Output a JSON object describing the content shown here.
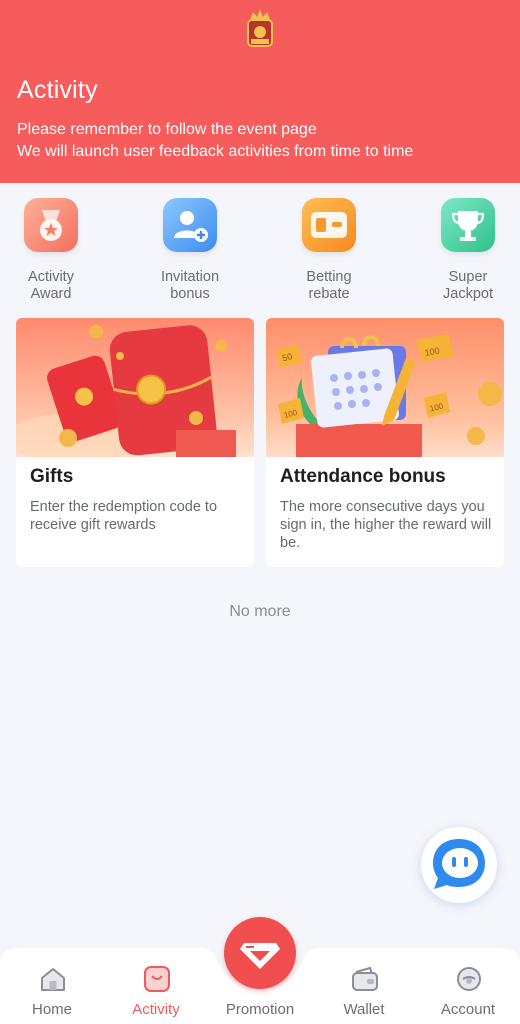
{
  "header": {
    "title": "Activity",
    "line1": "Please remember to follow the event page",
    "line2": "We will launch user feedback activities from time to time"
  },
  "quick": [
    {
      "label": "Activity\nAward",
      "icon": "medal-icon"
    },
    {
      "label": "Invitation\nbonus",
      "icon": "add-user-icon"
    },
    {
      "label": "Betting\nrebate",
      "icon": "wallet-icon"
    },
    {
      "label": "Super\nJackpot",
      "icon": "trophy-icon"
    }
  ],
  "cards": [
    {
      "title": "Gifts",
      "desc": "Enter the redemption code to receive gift rewards"
    },
    {
      "title": "Attendance bonus",
      "desc": "The more consecutive days you sign in, the higher the reward will be."
    }
  ],
  "no_more": "No more",
  "tabs": {
    "home": "Home",
    "activity": "Activity",
    "promotion": "Promotion",
    "wallet": "Wallet",
    "account": "Account"
  },
  "colors": {
    "brand": "#f65c5c",
    "active": "#f05a5a"
  }
}
